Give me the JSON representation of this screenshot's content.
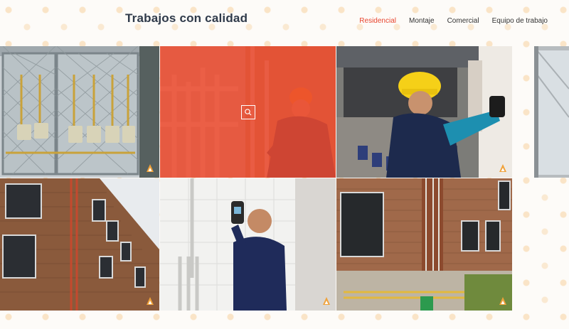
{
  "header": {
    "site_title": "Trabajos con calidad",
    "nav": [
      {
        "label": "Residencial",
        "active": true
      },
      {
        "label": "Montaje",
        "active": false
      },
      {
        "label": "Comercial",
        "active": false
      },
      {
        "label": "Equipo de trabajo",
        "active": false
      }
    ]
  },
  "colors": {
    "accent": "#e8452f",
    "overlay": "#eb492d",
    "title": "#2f3a4a",
    "badge": "#f0a23a"
  },
  "gallery": {
    "tiles": [
      {
        "photo": "gas-meters-cabinet"
      },
      {
        "photo": "technician-orange-helmet-pipes",
        "hovered": true,
        "hover_icon": "zoom-icon"
      },
      {
        "photo": "technician-yellow-helmet-rooftop"
      },
      {
        "photo": "window-partial"
      },
      {
        "photo": "brick-building-pipes"
      },
      {
        "photo": "technician-measuring-wall"
      },
      {
        "photo": "building-facade-gas-pipes"
      }
    ]
  }
}
